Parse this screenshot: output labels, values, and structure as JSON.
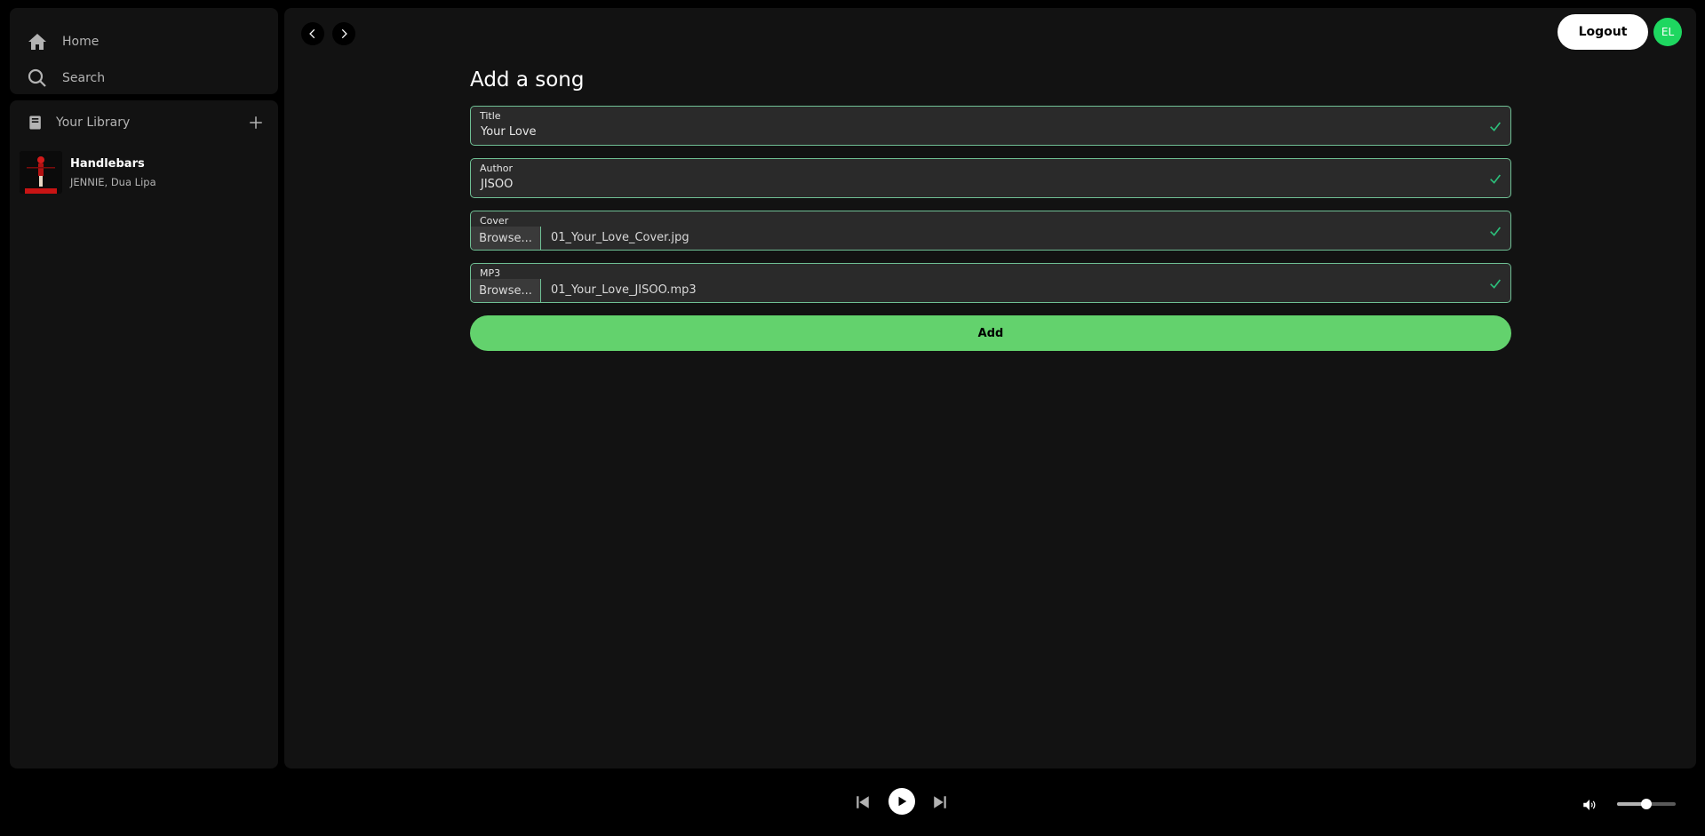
{
  "sidebar": {
    "nav": [
      {
        "label": "Home",
        "icon": "home-icon"
      },
      {
        "label": "Search",
        "icon": "search-icon"
      }
    ],
    "library": {
      "title": "Your Library",
      "items": [
        {
          "name": "Handlebars",
          "artists": "JENNIE, Dua Lipa"
        }
      ]
    }
  },
  "header": {
    "logout_label": "Logout",
    "avatar_initials": "EL"
  },
  "form": {
    "title": "Add a song",
    "fields": {
      "title": {
        "label": "Title",
        "value": "Your Love"
      },
      "author": {
        "label": "Author",
        "value": "JISOO"
      },
      "cover": {
        "label": "Cover",
        "browse_label": "Browse...",
        "file": "01_Your_Love_Cover.jpg"
      },
      "mp3": {
        "label": "MP3",
        "browse_label": "Browse...",
        "file": "01_Your_Love_JISOO.mp3"
      }
    },
    "submit_label": "Add"
  },
  "player": {
    "volume": 0.5
  },
  "colors": {
    "accent": "#63d26d",
    "valid_border": "#6fbf94",
    "check": "#2cbe7a",
    "avatar": "#1ed760"
  }
}
